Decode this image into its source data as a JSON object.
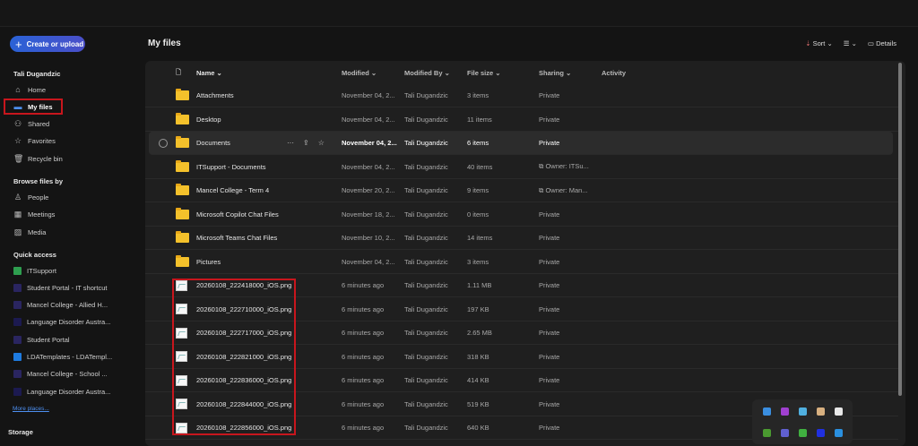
{
  "sidebar": {
    "create_label": "Create or upload",
    "user": "Tali Dugandzic",
    "nav": [
      {
        "label": "Home",
        "icon": "home-icon"
      },
      {
        "label": "My files",
        "icon": "folder-icon"
      },
      {
        "label": "Shared",
        "icon": "people-icon"
      },
      {
        "label": "Favorites",
        "icon": "star-icon"
      },
      {
        "label": "Recycle bin",
        "icon": "trash-icon"
      }
    ],
    "browse_title": "Browse files by",
    "browse": [
      {
        "label": "People",
        "icon": "person-icon"
      },
      {
        "label": "Meetings",
        "icon": "calendar-icon"
      },
      {
        "label": "Media",
        "icon": "image-icon"
      }
    ],
    "quick_title": "Quick access",
    "quick": [
      {
        "label": "ITSupport",
        "color": "#2e9e4f"
      },
      {
        "label": "Student Portal - IT shortcut",
        "color": "#2a2560"
      },
      {
        "label": "Mancel College - Allied H...",
        "color": "#2a2560"
      },
      {
        "label": "Language Disorder Austra...",
        "color": "#1c1a50"
      },
      {
        "label": "Student Portal",
        "color": "#2a2560"
      },
      {
        "label": "LDATemplates - LDATempl...",
        "color": "#1e7be0"
      },
      {
        "label": "Mancel College - School ...",
        "color": "#2a2560"
      },
      {
        "label": "Language Disorder Austra...",
        "color": "#1c1a50"
      }
    ],
    "more": "More places...",
    "storage": "Storage"
  },
  "main": {
    "title": "My files",
    "sort": "Sort",
    "details": "Details",
    "columns": {
      "name": "Name",
      "modified": "Modified",
      "modified_by": "Modified By",
      "size": "File size",
      "sharing": "Sharing",
      "activity": "Activity"
    },
    "rows": [
      {
        "name": "Attachments",
        "type": "folder",
        "modified": "November 04, 2...",
        "by": "Tali Dugandzic",
        "size": "3 items",
        "sharing": "Private"
      },
      {
        "name": "Desktop",
        "type": "folder",
        "modified": "November 04, 2...",
        "by": "Tali Dugandzic",
        "size": "11 items",
        "sharing": "Private"
      },
      {
        "name": "Documents",
        "type": "folder",
        "modified": "November 04, 2...",
        "by": "Tali Dugandzic",
        "size": "6 items",
        "sharing": "Private"
      },
      {
        "name": "ITSupport - Documents",
        "type": "shared-folder",
        "modified": "November 04, 2...",
        "by": "Tali Dugandzic",
        "size": "40 items",
        "sharing": "Owner: ITSu..."
      },
      {
        "name": "Mancel College - Term 4",
        "type": "shared-folder",
        "modified": "November 20, 2...",
        "by": "Tali Dugandzic",
        "size": "9 items",
        "sharing": "Owner: Man..."
      },
      {
        "name": "Microsoft Copilot Chat Files",
        "type": "folder",
        "modified": "November 18, 2...",
        "by": "Tali Dugandzic",
        "size": "0 items",
        "sharing": "Private"
      },
      {
        "name": "Microsoft Teams Chat Files",
        "type": "folder",
        "modified": "November 10, 2...",
        "by": "Tali Dugandzic",
        "size": "14 items",
        "sharing": "Private"
      },
      {
        "name": "Pictures",
        "type": "folder",
        "modified": "November 04, 2...",
        "by": "Tali Dugandzic",
        "size": "3 items",
        "sharing": "Private"
      },
      {
        "name": "20260108_222418000_iOS.png",
        "type": "image",
        "modified": "6 minutes ago",
        "by": "Tali Dugandzic",
        "size": "1.11 MB",
        "sharing": "Private"
      },
      {
        "name": "20260108_222710000_iOS.png",
        "type": "image",
        "modified": "6 minutes ago",
        "by": "Tali Dugandzic",
        "size": "197 KB",
        "sharing": "Private"
      },
      {
        "name": "20260108_222717000_iOS.png",
        "type": "image",
        "modified": "6 minutes ago",
        "by": "Tali Dugandzic",
        "size": "2.65 MB",
        "sharing": "Private"
      },
      {
        "name": "20260108_222821000_iOS.png",
        "type": "image",
        "modified": "6 minutes ago",
        "by": "Tali Dugandzic",
        "size": "318 KB",
        "sharing": "Private"
      },
      {
        "name": "20260108_222836000_iOS.png",
        "type": "image",
        "modified": "6 minutes ago",
        "by": "Tali Dugandzic",
        "size": "414 KB",
        "sharing": "Private"
      },
      {
        "name": "20260108_222844000_iOS.png",
        "type": "image",
        "modified": "6 minutes ago",
        "by": "Tali Dugandzic",
        "size": "519 KB",
        "sharing": "Private"
      },
      {
        "name": "20260108_222856000_iOS.png",
        "type": "image",
        "modified": "6 minutes ago",
        "by": "Tali Dugandzic",
        "size": "640 KB",
        "sharing": "Private"
      }
    ]
  },
  "tray": {
    "icons": [
      {
        "name": "app-icon",
        "color": "#3a8ee0"
      },
      {
        "name": "app-icon",
        "color": "#a040d0"
      },
      {
        "name": "app-icon",
        "color": "#50b0e0"
      },
      {
        "name": "mail-icon",
        "color": "#d8b080"
      },
      {
        "name": "window-icon",
        "color": "#e8e8e8"
      },
      {
        "name": "sync-icon",
        "color": "#4a9a30"
      },
      {
        "name": "app-icon",
        "color": "#6060d0"
      },
      {
        "name": "app-icon",
        "color": "#40b040"
      },
      {
        "name": "app-icon",
        "color": "#2030e0"
      },
      {
        "name": "warning-icon",
        "color": "#2a90e0"
      }
    ]
  }
}
